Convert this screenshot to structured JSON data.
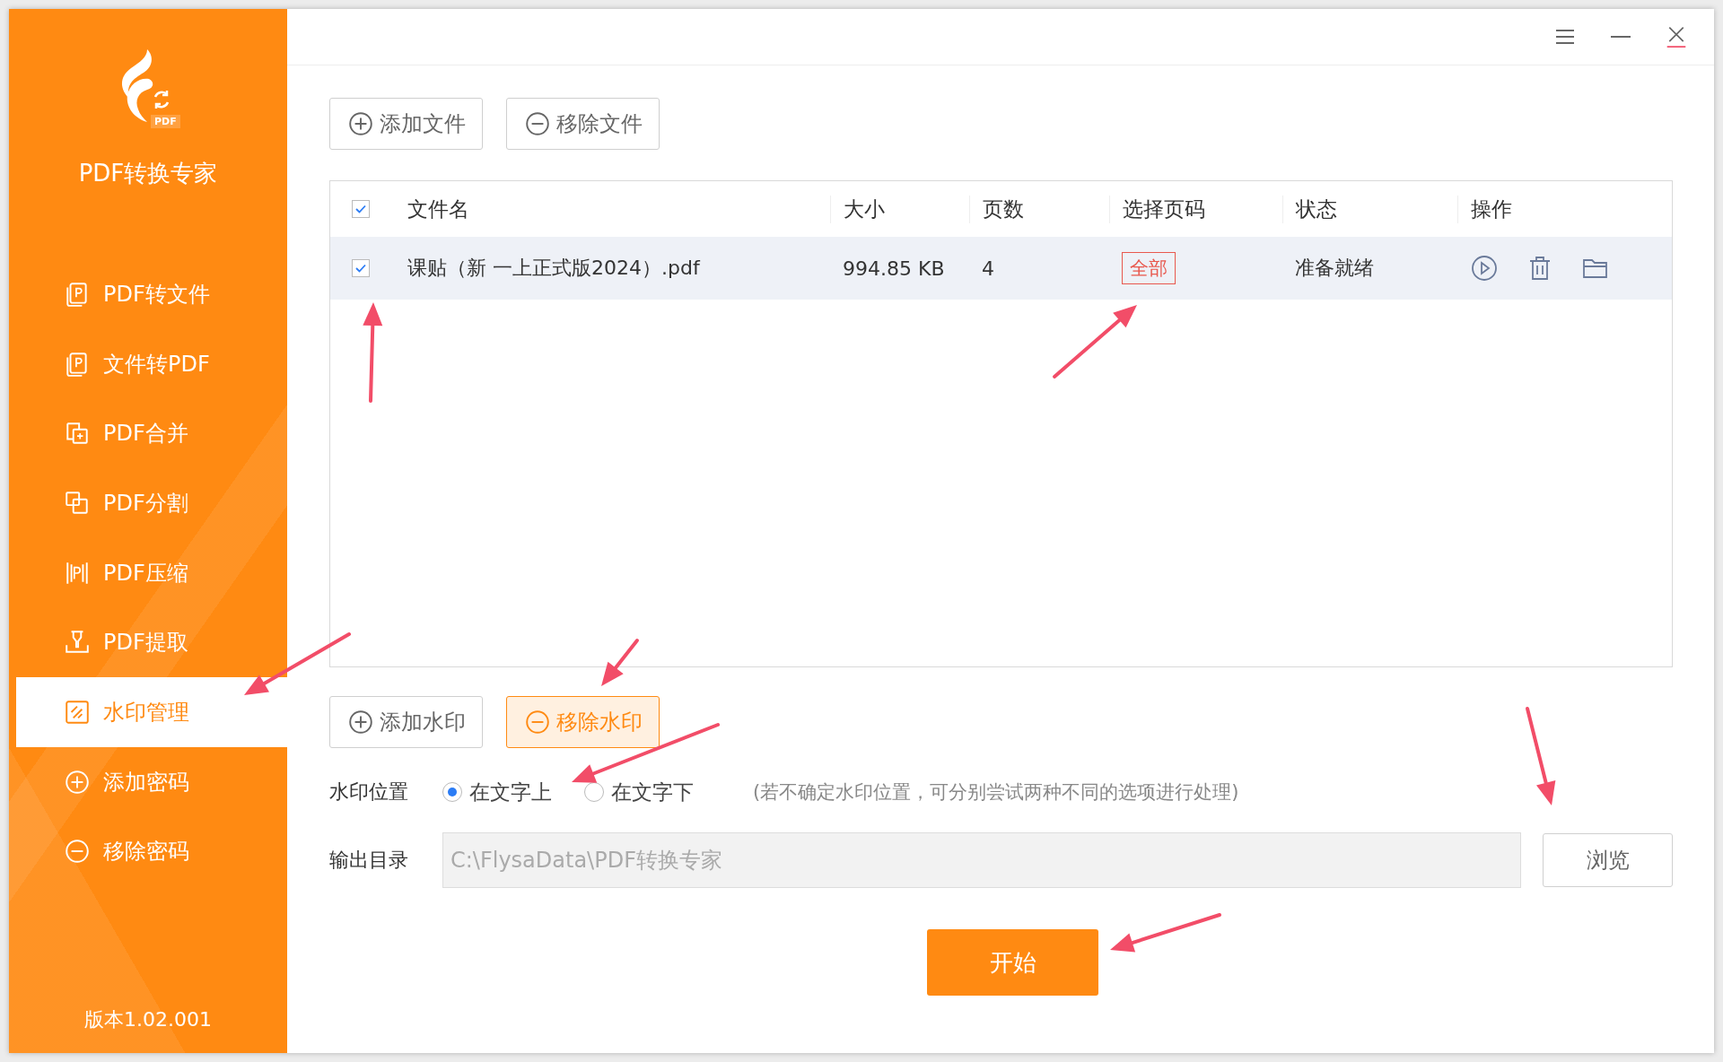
{
  "app": {
    "logo_badge": "PDF",
    "name": "PDF转换专家",
    "version": "版本1.02.001"
  },
  "sidebar": {
    "items": [
      {
        "label": "PDF转文件",
        "kind": "pdf-to-file",
        "selected": false
      },
      {
        "label": "文件转PDF",
        "kind": "file-to-pdf",
        "selected": false
      },
      {
        "label": "PDF合并",
        "kind": "merge",
        "selected": false
      },
      {
        "label": "PDF分割",
        "kind": "split",
        "selected": false
      },
      {
        "label": "PDF压缩",
        "kind": "compress",
        "selected": false
      },
      {
        "label": "PDF提取",
        "kind": "extract",
        "selected": false
      },
      {
        "label": "水印管理",
        "kind": "watermark",
        "selected": true
      },
      {
        "label": "添加密码",
        "kind": "add",
        "selected": false
      },
      {
        "label": "移除密码",
        "kind": "remove",
        "selected": false
      }
    ]
  },
  "file_toolbar": [
    {
      "label": "添加文件",
      "kind": "add",
      "selected": false
    },
    {
      "label": "移除文件",
      "kind": "remove",
      "selected": false
    }
  ],
  "table": {
    "all_checked": true,
    "columns": [
      "文件名",
      "大小",
      "页数",
      "选择页码",
      "状态",
      "操作"
    ],
    "rows": [
      {
        "checked": true,
        "selected": true,
        "file_name": "课贴（新 一上正式版2024）.pdf",
        "size": "994.85 KB",
        "pages": "4",
        "page_range": "全部",
        "status": "准备就绪"
      }
    ]
  },
  "watermark_toolbar": [
    {
      "label": "添加水印",
      "kind": "add",
      "selected": false
    },
    {
      "label": "移除水印",
      "kind": "remove",
      "selected": true
    }
  ],
  "watermark_position": {
    "label": "水印位置",
    "options": [
      {
        "label": "在文字上",
        "selected": true
      },
      {
        "label": "在文字下",
        "selected": false
      }
    ],
    "hint": "(若不确定水印位置，可分别尝试两种不同的选项进行处理)"
  },
  "output": {
    "label": "输出目录",
    "value": "C:\\FlysaData\\PDF转换专家",
    "disabled": true,
    "browse": "浏览"
  },
  "start_button": "开始"
}
